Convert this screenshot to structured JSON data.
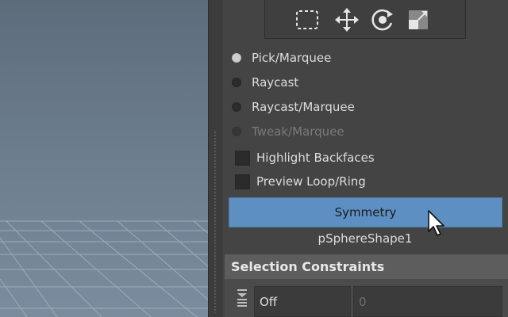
{
  "toolbar": {
    "tools": [
      {
        "icon": "marquee-select-icon"
      },
      {
        "icon": "move-icon"
      },
      {
        "icon": "rotate-icon"
      },
      {
        "icon": "scale-icon"
      }
    ]
  },
  "selection_modes": [
    {
      "label": "Pick/Marquee",
      "selected": true,
      "enabled": true
    },
    {
      "label": "Raycast",
      "selected": false,
      "enabled": true
    },
    {
      "label": "Raycast/Marquee",
      "selected": false,
      "enabled": true
    },
    {
      "label": "Tweak/Marquee",
      "selected": false,
      "enabled": false
    }
  ],
  "options": [
    {
      "label": "Highlight Backfaces",
      "checked": false
    },
    {
      "label": "Preview Loop/Ring",
      "checked": false
    }
  ],
  "symmetry": {
    "button_label": "Symmetry",
    "shape_name": "pSphereShape1"
  },
  "constraints": {
    "section_title": "Selection Constraints",
    "mode_value": "Off",
    "count_value": "0"
  },
  "colors": {
    "accent_button": "#5d8fc3",
    "panel_bg": "#444444",
    "viewport_top": "#5d6c7b",
    "viewport_bottom": "#7a8c9e"
  }
}
